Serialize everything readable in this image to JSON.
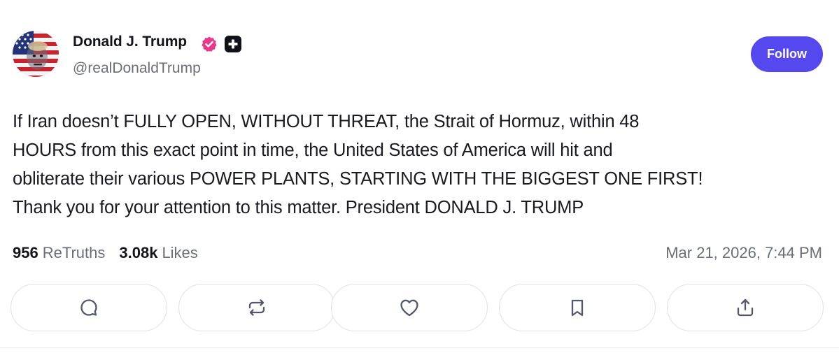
{
  "author": {
    "name": "Donald J. Trump",
    "handle": "@realDonaldTrump",
    "avatar_icon": "avatar-flag-portrait",
    "verified_icon": "verified-badge-icon",
    "plus_icon": "plus-badge-icon"
  },
  "follow_button": {
    "label": "Follow",
    "color": "#5448ee"
  },
  "post": {
    "lines": [
      "If Iran doesn’t FULLY OPEN, WITHOUT THREAT, the Strait of Hormuz, within 48",
      "HOURS from this exact point in time, the United States of America will hit and",
      "obliterate their various POWER PLANTS, STARTING WITH THE BIGGEST ONE FIRST!",
      "Thank you for your attention to this matter. President DONALD J. TRUMP"
    ]
  },
  "stats": {
    "retruths_count": "956",
    "retruths_label": "ReTruths",
    "likes_count": "3.08k",
    "likes_label": "Likes"
  },
  "timestamp": "Mar 21, 2026, 7:44 PM",
  "actions": [
    {
      "name": "reply",
      "icon": "comment-icon"
    },
    {
      "name": "retruth",
      "icon": "repost-icon"
    },
    {
      "name": "like",
      "icon": "heart-icon"
    },
    {
      "name": "bookmark",
      "icon": "bookmark-icon"
    },
    {
      "name": "share",
      "icon": "share-icon"
    }
  ],
  "colors": {
    "accent": "#5448ee",
    "verified": "#e9398b",
    "text_primary": "#14151b",
    "text_secondary": "#6b6e7a"
  }
}
